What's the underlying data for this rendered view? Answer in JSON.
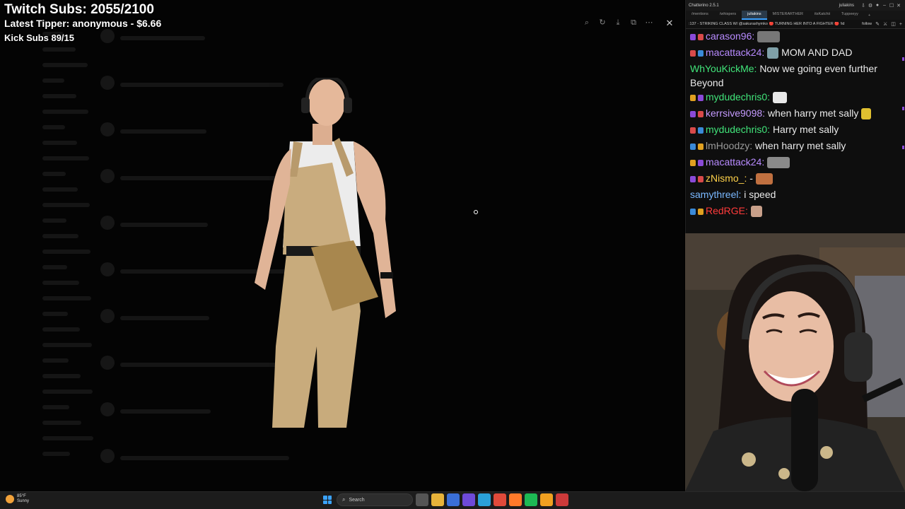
{
  "overlay": {
    "twitch_subs": "Twitch Subs: 2055/2100",
    "latest_tipper": "Latest Tipper: anonymous - $6.66",
    "kick_subs": "Kick Subs 89/15"
  },
  "chat_app": {
    "title": "Chatterino 2.5.1",
    "user": "juliakins",
    "tabs": [
      "/mentions",
      "/whispers",
      "juliakins",
      "MISTERARTHER",
      "itsKatchii",
      "Tuppeeyy"
    ],
    "active_tab": 2,
    "add_tab": "+",
    "header_title": ":137 - STRIKING CLASS W/ @sakurashymko 🔴 TURNING HER INTO A FIGHTER 🔴 !id",
    "header_follow": "follow"
  },
  "chat_messages": [
    {
      "user": "carason96:",
      "color": "#b88bff",
      "text": "",
      "emote": "#777777",
      "emote_w": 32
    },
    {
      "user": "macattack24:",
      "color": "#b88bff",
      "text": "MOM AND DAD",
      "emote": "#7fa0a8",
      "emote_w": 16
    },
    {
      "user": "WhYouKickMe:",
      "color": "#41e57a",
      "text": "Now we going even further Beyond",
      "emote": "",
      "emote_w": 0
    },
    {
      "user": "mydudechris0:",
      "color": "#41e57a",
      "text": "",
      "emote": "#e8e8e8",
      "emote_w": 20
    },
    {
      "user": "kerrsive9098:",
      "color": "#c59bff",
      "text": "when harry met sally",
      "emote": "#e0c030",
      "emote_w": 14
    },
    {
      "user": "mydudechris0:",
      "color": "#41e57a",
      "text": "Harry met sally",
      "emote": "",
      "emote_w": 0
    },
    {
      "user": "lmHoodzy:",
      "color": "#9a9a9a",
      "text": "when harry met sally",
      "emote": "",
      "emote_w": 0
    },
    {
      "user": "macattack24:",
      "color": "#b88bff",
      "text": "",
      "emote": "#8a8a8a",
      "emote_w": 32
    },
    {
      "user": "zNismo_:",
      "color": "#ffd24a",
      "text": "-",
      "emote": "#c07040",
      "emote_w": 24
    },
    {
      "user": "samythreel:",
      "color": "#7ab8ff",
      "text": "i speed",
      "emote": "",
      "emote_w": 0
    },
    {
      "user": "RedRGE:",
      "color": "#ff3b3b",
      "text": "",
      "emote": "#c8a08a",
      "emote_w": 16
    }
  ],
  "taskbar": {
    "weather_temp": "85°F",
    "weather_desc": "Sunny",
    "search_label": "Search",
    "apps": [
      {
        "icon": "task-view-icon",
        "color": "#555555"
      },
      {
        "icon": "file-explorer-icon",
        "color": "#e8b33a"
      },
      {
        "icon": "store-icon",
        "color": "#3a6fd8"
      },
      {
        "icon": "chatterino-icon",
        "color": "#6e4ad8"
      },
      {
        "icon": "edge-icon",
        "color": "#2aa0d8"
      },
      {
        "icon": "chrome-icon",
        "color": "#e04a3a"
      },
      {
        "icon": "firefox-icon",
        "color": "#ff7a2a"
      },
      {
        "icon": "spotify-icon",
        "color": "#1db954"
      },
      {
        "icon": "chrome-canary-icon",
        "color": "#f0a020"
      },
      {
        "icon": "obs-icon",
        "color": "#cc3a3a"
      }
    ]
  }
}
